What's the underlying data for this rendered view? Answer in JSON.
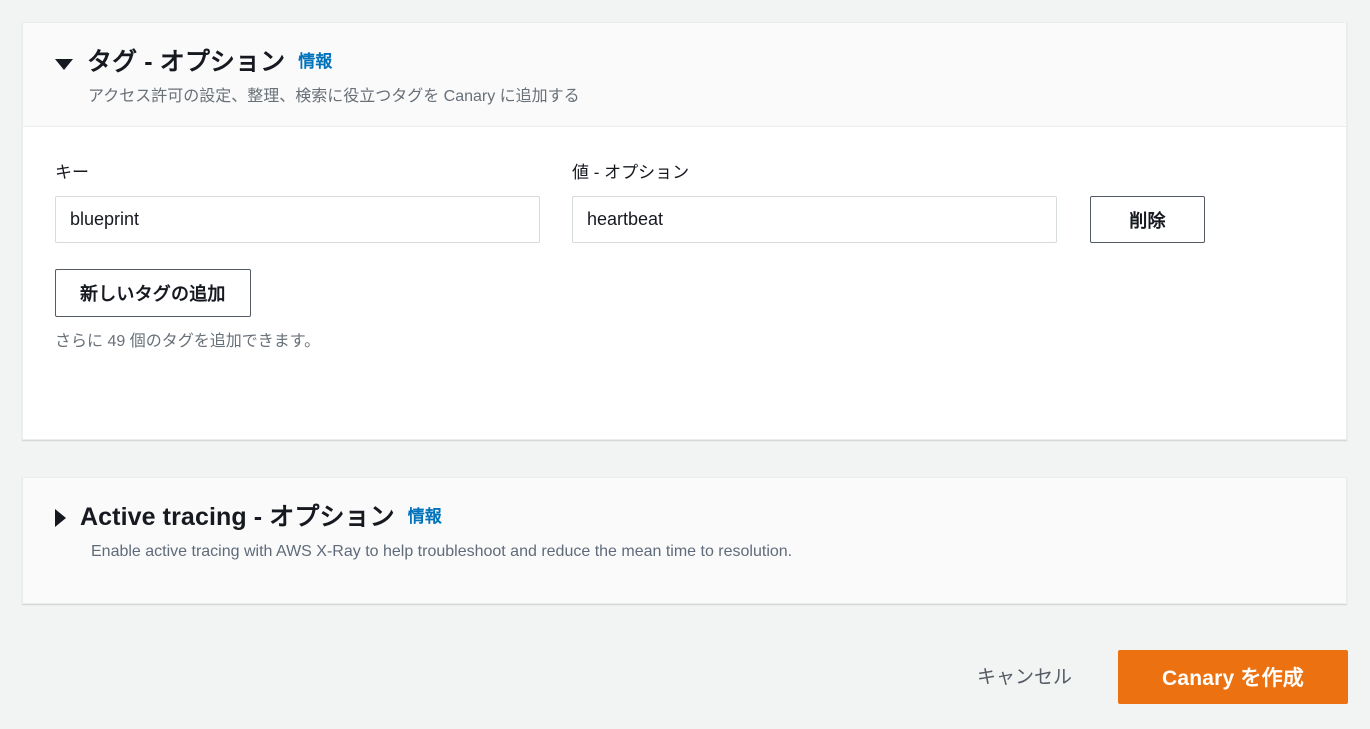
{
  "colors": {
    "accent_orange": "#ec7211",
    "link_blue": "#0073bb",
    "page_background": "#f2f3f3",
    "panel_background": "#ffffff",
    "panel_header_background": "#fafafa",
    "border": "#eaeded",
    "input_border": "#d5dbdb",
    "muted_text": "#687078",
    "text": "#16191f"
  },
  "tags_section": {
    "caret_icon": "caret-down-icon",
    "title": "タグ - オプション",
    "info_label": "情報",
    "description": "アクセス許可の設定、整理、検索に役立つタグを Canary に追加する",
    "key_label": "キー",
    "value_label": "値 - オプション",
    "rows": [
      {
        "key": "blueprint",
        "value": "heartbeat",
        "key_placeholder": "",
        "value_placeholder": "",
        "remove_label": "削除"
      }
    ],
    "add_tag_label": "新しいタグの追加",
    "remaining_hint": "さらに 49 個のタグを追加できます。"
  },
  "tracing_section": {
    "caret_icon": "caret-right-icon",
    "title": "Active tracing - オプション",
    "info_label": "情報",
    "description": "Enable active tracing with AWS X-Ray to help troubleshoot and reduce the mean time to resolution."
  },
  "footer": {
    "cancel_label": "キャンセル",
    "submit_label": "Canary を作成"
  }
}
